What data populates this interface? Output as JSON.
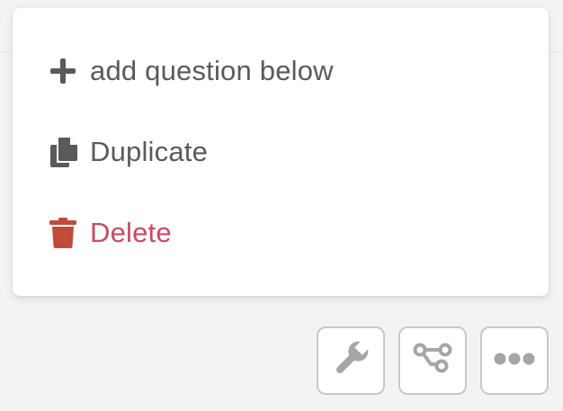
{
  "menu": {
    "items": [
      {
        "label": "add question below",
        "icon": "plus-icon"
      },
      {
        "label": "Duplicate",
        "icon": "copy-icon"
      },
      {
        "label": "Delete",
        "icon": "trash-icon"
      }
    ]
  },
  "toolbar": {
    "buttons": [
      {
        "icon": "wrench-icon"
      },
      {
        "icon": "branch-icon"
      },
      {
        "icon": "ellipsis-icon"
      }
    ]
  },
  "colors": {
    "text": "#5a5a5a",
    "icon": "#5a5a5a",
    "delete_text": "#cc4a60",
    "delete_icon": "#c24a3b",
    "toolbar_icon": "#a6a6a6",
    "background": "#f3f3f3"
  }
}
